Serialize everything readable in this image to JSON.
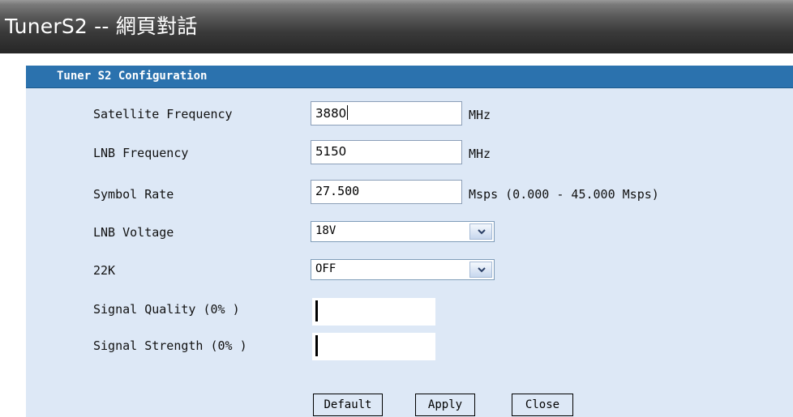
{
  "window": {
    "title": "TunerS2 -- 網頁對話"
  },
  "panel": {
    "header": "Tuner S2 Configuration"
  },
  "fields": {
    "satellite_frequency": {
      "label": "Satellite Frequency",
      "value": "3880",
      "unit": "MHz"
    },
    "lnb_frequency": {
      "label": "LNB Frequency",
      "value": "5150",
      "unit": "MHz"
    },
    "symbol_rate": {
      "label": "Symbol Rate",
      "value": "27.500",
      "unit": "Msps (0.000 - 45.000 Msps)"
    },
    "lnb_voltage": {
      "label": "LNB Voltage",
      "selected": "18V"
    },
    "tone_22k": {
      "label": "22K",
      "selected": "OFF"
    },
    "signal_quality": {
      "label": "Signal Quality (0% )",
      "percent": 0
    },
    "signal_strength": {
      "label": "Signal Strength (0% )",
      "percent": 0
    }
  },
  "buttons": {
    "default": "Default",
    "apply": "Apply",
    "close": "Close"
  },
  "colors": {
    "header": "#2b72ae",
    "panel": "#dde8f6"
  }
}
